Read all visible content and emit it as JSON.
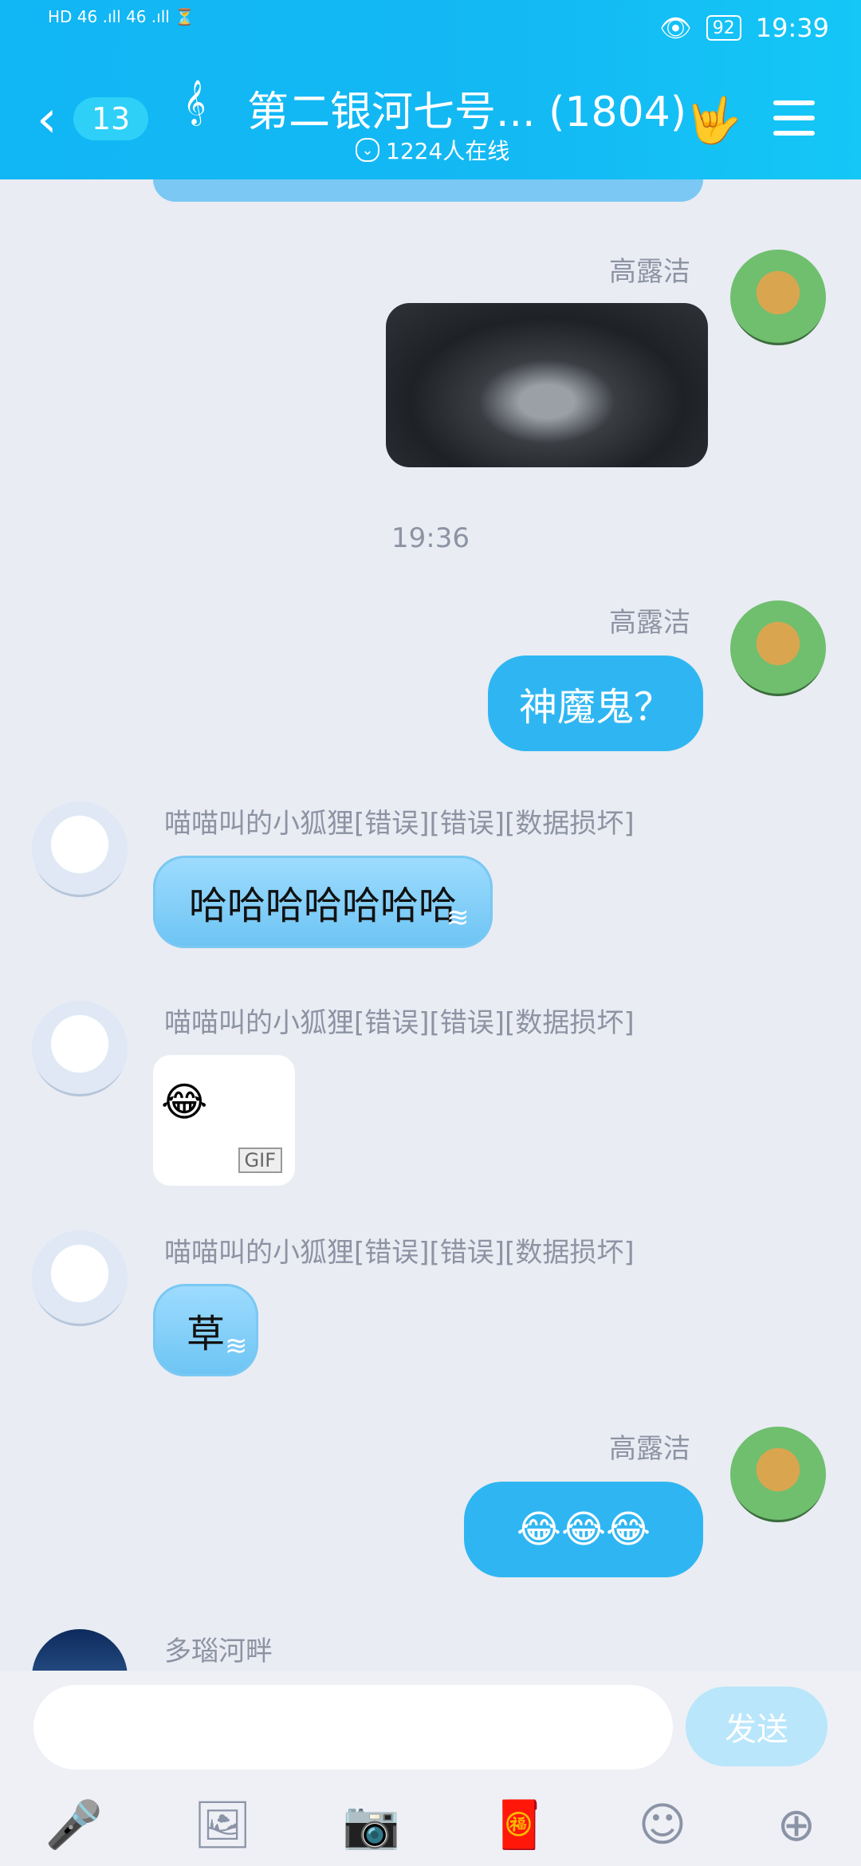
{
  "status": {
    "left": "HD 46 .ıll 46 .ıll ⏳",
    "battery": "92",
    "time": "19:39"
  },
  "header": {
    "back_badge": "13",
    "title": "第二银河七号... (1804)",
    "online": "1224人在线"
  },
  "chat": {
    "timestamp": "19:36",
    "messages": [
      {
        "name": "高露洁"
      },
      {
        "name": "高露洁",
        "text": "神魔鬼？"
      },
      {
        "name": "喵喵叫的小狐狸[错误][错误][数据损坏]",
        "text": "哈哈哈哈哈哈哈"
      },
      {
        "name": "喵喵叫的小狐狸[错误][错误][数据损坏]",
        "gif_label": "GIF"
      },
      {
        "name": "喵喵叫的小狐狸[错误][错误][数据损坏]",
        "text": "草"
      },
      {
        "name": "高露洁",
        "text": "😂😂😂"
      },
      {
        "name": "多瑙河畔"
      }
    ]
  },
  "input": {
    "placeholder": "",
    "send_label": "发送"
  },
  "tools": [
    "mic-icon",
    "image-icon",
    "camera-icon",
    "redpacket-icon",
    "emoji-icon",
    "plus-icon"
  ]
}
